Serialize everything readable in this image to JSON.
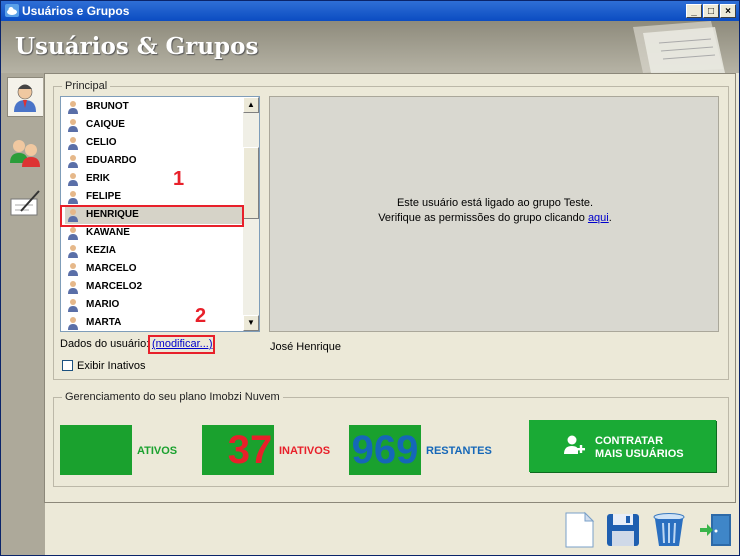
{
  "window": {
    "title": "Usuários e Grupos",
    "controls": [
      "_",
      "□",
      "×"
    ]
  },
  "header": {
    "title": "Usuários & Grupos"
  },
  "sidebar": {
    "buttons": [
      "user-icon",
      "group-icon",
      "edit-icon"
    ]
  },
  "principal": {
    "legend": "Principal",
    "users": [
      "BRUNOT",
      "CAIQUE",
      "CELIO",
      "EDUARDO",
      "ERIK",
      "FELIPE",
      "HENRIQUE",
      "KAWANE",
      "KEZIA",
      "MARCELO",
      "MARCELO2",
      "MARIO",
      "MARTA"
    ],
    "selected_user": "HENRIQUE",
    "info_line1": "Este usuário está ligado ao grupo Teste.",
    "info_line2_prefix": "Verifique as permissões do grupo clicando ",
    "info_link": "aqui",
    "info_line2_suffix": ".",
    "user_data_label": "Dados do usuário:",
    "modify_link": "(modificar...)",
    "user_full_name": "José Henrique",
    "show_inactive_label": "Exibir Inativos",
    "show_inactive_checked": false
  },
  "plan": {
    "legend": "Gerenciamento do seu plano Imobzi Nuvem",
    "active_value": "",
    "active_label": "ATIVOS",
    "inactive_value": "37",
    "inactive_label": "INATIVOS",
    "remaining_value": "969",
    "remaining_label": "RESTANTES",
    "cta_line1": "CONTRATAR",
    "cta_line2": "MAIS USUÁRIOS"
  },
  "annotations": {
    "one": "1",
    "two": "2"
  },
  "colors": {
    "green": "#1aa12e",
    "red": "#e8202a",
    "blue": "#1567b8",
    "label_green": "#1aa12e"
  },
  "footer": {
    "icons": [
      "new-document-icon",
      "save-icon",
      "trash-icon",
      "exit-door-icon"
    ]
  }
}
